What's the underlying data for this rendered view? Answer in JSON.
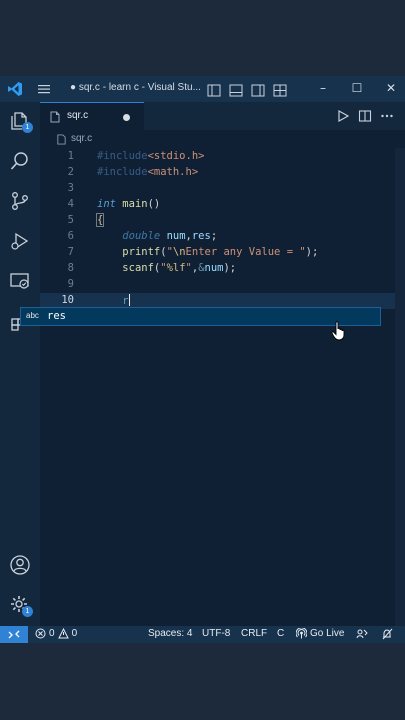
{
  "window": {
    "title": "● sqr.c - learn c - Visual Stu...",
    "controls": [
      "–",
      "☐",
      "✕"
    ]
  },
  "activity_bar": {
    "explorer_badge": "1",
    "settings_badge": "1"
  },
  "tabs": [
    {
      "label": "sqr.c",
      "modified": true
    }
  ],
  "breadcrumb": {
    "file": "sqr.c"
  },
  "editor": {
    "active_line": 10,
    "line_numbers": [
      "1",
      "2",
      "3",
      "4",
      "5",
      "6",
      "7",
      "8",
      "9",
      "10"
    ]
  },
  "suggest": {
    "kind": "abc",
    "label": "res"
  },
  "statusbar": {
    "errors": "0",
    "warnings": "0",
    "spaces": "Spaces: 4",
    "encoding": "UTF-8",
    "eol": "CRLF",
    "language": "C",
    "live": "Go Live"
  },
  "colors": {
    "accent": "#2f82d4",
    "editor_bg": "#0f2035",
    "statusbar_bg": "#16324d"
  }
}
